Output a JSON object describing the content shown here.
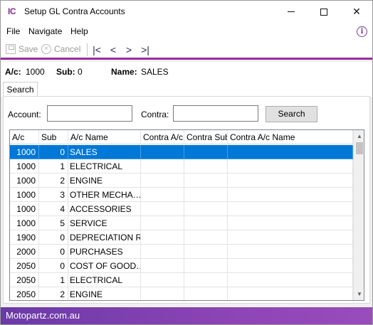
{
  "window": {
    "app_icon_text": "IC",
    "title": "Setup GL Contra Accounts",
    "minimize_glyph": "",
    "close_glyph": "✕"
  },
  "menu": {
    "file": "File",
    "navigate": "Navigate",
    "help": "Help",
    "info_glyph": "i"
  },
  "toolbar": {
    "save_label": "Save",
    "cancel_label": "Cancel",
    "cancel_glyph": "×",
    "first_glyph": "|<",
    "prev_glyph": "<",
    "next_glyph": ">",
    "last_glyph": ">|"
  },
  "header": {
    "ac_label": "A/c:",
    "ac_value": "1000",
    "sub_label": "Sub:",
    "sub_value": "0",
    "name_label": "Name:",
    "name_value": "SALES"
  },
  "tabs": [
    {
      "label": "Search"
    }
  ],
  "search": {
    "account_label": "Account:",
    "account_value": "",
    "contra_label": "Contra:",
    "contra_value": "",
    "button_label": "Search"
  },
  "grid": {
    "columns": [
      "A/c",
      "Sub",
      "A/c Name",
      "Contra A/c",
      "Contra Sub",
      "Contra A/c Name"
    ],
    "rows": [
      {
        "ac": "1000",
        "sub": "0",
        "name": "SALES",
        "contra_ac": "",
        "contra_sub": "",
        "contra_name": ""
      },
      {
        "ac": "1000",
        "sub": "1",
        "name": "ELECTRICAL",
        "contra_ac": "",
        "contra_sub": "",
        "contra_name": ""
      },
      {
        "ac": "1000",
        "sub": "2",
        "name": "ENGINE",
        "contra_ac": "",
        "contra_sub": "",
        "contra_name": ""
      },
      {
        "ac": "1000",
        "sub": "3",
        "name": "OTHER MECHA…",
        "contra_ac": "",
        "contra_sub": "",
        "contra_name": ""
      },
      {
        "ac": "1000",
        "sub": "4",
        "name": "ACCESSORIES",
        "contra_ac": "",
        "contra_sub": "",
        "contra_name": ""
      },
      {
        "ac": "1000",
        "sub": "5",
        "name": "SERVICE",
        "contra_ac": "",
        "contra_sub": "",
        "contra_name": ""
      },
      {
        "ac": "1900",
        "sub": "0",
        "name": "DEPRECIATION R…",
        "contra_ac": "",
        "contra_sub": "",
        "contra_name": ""
      },
      {
        "ac": "2000",
        "sub": "0",
        "name": "PURCHASES",
        "contra_ac": "",
        "contra_sub": "",
        "contra_name": ""
      },
      {
        "ac": "2050",
        "sub": "0",
        "name": "COST OF GOOD…",
        "contra_ac": "",
        "contra_sub": "",
        "contra_name": ""
      },
      {
        "ac": "2050",
        "sub": "1",
        "name": "ELECTRICAL",
        "contra_ac": "",
        "contra_sub": "",
        "contra_name": ""
      },
      {
        "ac": "2050",
        "sub": "2",
        "name": "ENGINE",
        "contra_ac": "",
        "contra_sub": "",
        "contra_name": ""
      }
    ],
    "selected_row": 0,
    "scroll_up_glyph": "▲",
    "scroll_down_glyph": "▼"
  },
  "status": {
    "text": "Motopartz.com.au"
  },
  "colors": {
    "accent": "#9a2a9e",
    "selection": "#0078d7",
    "status_bar": "#7b3fae"
  }
}
